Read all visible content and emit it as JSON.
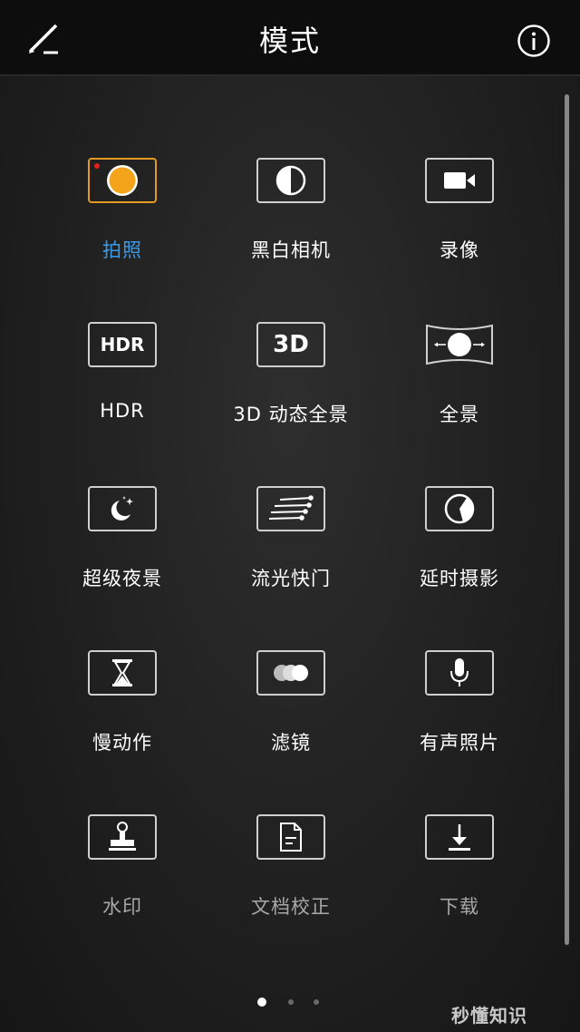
{
  "header": {
    "title": "模式"
  },
  "modes": [
    {
      "label": "拍照",
      "icon": "shutter-icon"
    },
    {
      "label": "黑白相机",
      "icon": "monochrome-icon"
    },
    {
      "label": "录像",
      "icon": "video-camera-icon"
    },
    {
      "label": "HDR",
      "icon": "hdr-icon",
      "icon_text": "HDR"
    },
    {
      "label": "3D 动态全景",
      "icon": "3d-panorama-icon",
      "icon_text": "3D"
    },
    {
      "label": "全景",
      "icon": "panorama-icon"
    },
    {
      "label": "超级夜景",
      "icon": "night-mode-icon"
    },
    {
      "label": "流光快门",
      "icon": "light-trail-icon"
    },
    {
      "label": "延时摄影",
      "icon": "time-lapse-icon"
    },
    {
      "label": "慢动作",
      "icon": "hourglass-icon"
    },
    {
      "label": "滤镜",
      "icon": "filter-icon"
    },
    {
      "label": "有声照片",
      "icon": "microphone-icon"
    },
    {
      "label": "水印",
      "icon": "stamp-icon"
    },
    {
      "label": "文档校正",
      "icon": "document-icon"
    },
    {
      "label": "下载",
      "icon": "download-icon"
    }
  ],
  "active_mode": "拍照",
  "pager": {
    "pages": 3,
    "current": 1
  },
  "watermark": "秒懂知识",
  "colors": {
    "accent_orange": "#e39a20",
    "active_label": "#3b9be8",
    "record_dot": "#e02020"
  }
}
